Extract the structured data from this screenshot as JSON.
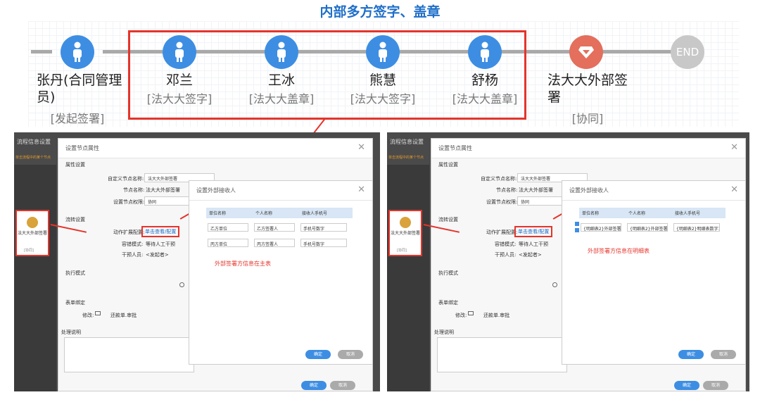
{
  "title": "内部多方签字、盖章",
  "flow": [
    {
      "name": "张丹(合同管理员)",
      "role": "[发起签署]",
      "icon": "person-icon"
    },
    {
      "name": "邓兰",
      "role": "[法大大签字]",
      "icon": "person-icon"
    },
    {
      "name": "王冰",
      "role": "[法大大盖章]",
      "icon": "person-icon"
    },
    {
      "name": "熊慧",
      "role": "[法大大签字]",
      "icon": "person-icon"
    },
    {
      "name": "舒杨",
      "role": "[法大大盖章]",
      "icon": "person-icon"
    },
    {
      "name": "法大大外部签署",
      "role": "[协同]",
      "icon": "gem-icon"
    },
    {
      "name": "END",
      "role": "",
      "icon": "end-icon"
    }
  ],
  "shots": [
    {
      "bg_title": "流程信息设置",
      "bg_subtitle": "单击流程中的某个节点",
      "node_dialog": {
        "title": "设置节点属性",
        "section_attr": "属性设置",
        "label_custom_name": "自定义节点名称:",
        "custom_name": "法大大外部签署",
        "label_node_name": "节点名称:",
        "node_name": "法大大外部签署",
        "label_permission": "设置节点权限:",
        "permission": "协同",
        "section_flow": "流转设置",
        "label_action": "动作扩展配置:",
        "action_link": "单击查看/配置",
        "label_error": "容错模式:",
        "error_mode": "等待人工干预",
        "label_intervene": "干预人员:",
        "intervene": "<发起者>",
        "section_exec": "执行模式",
        "section_form": "表单绑定",
        "label_modify": "修改:",
        "form_name": "还款单.审批",
        "section_note": "处理说明",
        "ok": "确定",
        "cancel": "取消"
      },
      "side_node": {
        "label": "法大大外部签署",
        "role": "[协同]"
      },
      "recv_dialog": {
        "title": "设置外部接收人",
        "headers": [
          "单位名称",
          "个人名称",
          "接收人手机号"
        ],
        "rows": [
          [
            "乙方单位",
            "乙方签署人",
            "手机号数字"
          ],
          [
            "丙方单位",
            "丙方签署人",
            "手机号数字"
          ]
        ],
        "note": "外部签署方信息在主表",
        "ok": "确定",
        "cancel": "取消"
      }
    },
    {
      "bg_title": "流程信息设置",
      "bg_subtitle": "单击流程中的某个节点",
      "node_dialog": {
        "title": "设置节点属性",
        "section_attr": "属性设置",
        "label_custom_name": "自定义节点名称:",
        "custom_name": "法大大外部签署",
        "label_node_name": "节点名称:",
        "node_name": "法大大外部签署",
        "label_permission": "设置节点权限:",
        "permission": "协同",
        "section_flow": "流转设置",
        "label_action": "动作扩展配置:",
        "action_link": "单击查看/配置",
        "label_error": "容错模式:",
        "error_mode": "等待人工干预",
        "label_intervene": "干预人员:",
        "intervene": "<发起者>",
        "section_exec": "执行模式",
        "section_form": "表单绑定",
        "label_modify": "修改:",
        "form_name": "还款单.审批",
        "section_note": "处理说明",
        "ok": "确定",
        "cancel": "取消"
      },
      "side_node": {
        "label": "法大大外部签署",
        "role": "[协同]"
      },
      "recv_dialog": {
        "title": "设置外部接收人",
        "headers": [
          "单位名称",
          "个人名称",
          "接收人手机号"
        ],
        "rows": [
          [
            "{明细表2}外部签署",
            "{明细表2}外部签署",
            "{明细表2}明细表数字1"
          ]
        ],
        "note": "外部签署方信息在明细表",
        "ok": "确定",
        "cancel": "取消"
      }
    }
  ],
  "colors": {
    "accent": "#1f6fc9",
    "highlight": "#e5342b",
    "node_blue": "#3d8ee3",
    "node_red": "#e36f5c"
  }
}
